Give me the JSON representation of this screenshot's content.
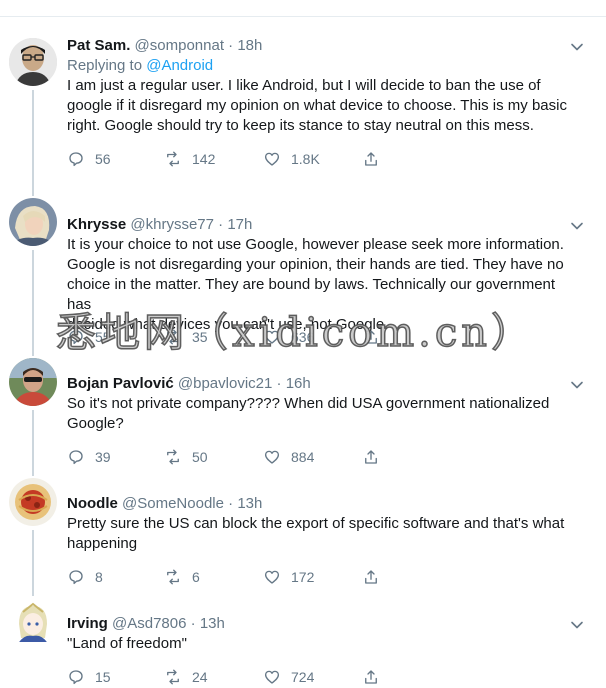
{
  "tweets": [
    {
      "name": "Pat Sam.",
      "handle": "@somponnat",
      "dot": "·",
      "time": "18h",
      "replying_prefix": "Replying to ",
      "replying_mention": "@Android",
      "lines": [
        "I am just a regular user. I like Android, but I will decide to ban the use of",
        "google if it disregard my opinion on what device to choose. This is my basic",
        "right. Google should try to keep its stance to stay neutral on this mess."
      ],
      "replies": "56",
      "retweets": "142",
      "likes": "1.8K"
    },
    {
      "name": "Khrysse",
      "handle": "@khrysse77",
      "dot": "·",
      "time": "17h",
      "lines": [
        "It is your choice to not use Google, however please seek more information.",
        "Google is not disregarding your opinion, their hands are tied. They have no",
        "choice in the matter. They are bound by laws. Technically our government has",
        "decided what devices you can't use, not Google."
      ],
      "replies": "55",
      "retweets": "35",
      "likes": "636"
    },
    {
      "name": "Bojan Pavlović",
      "handle": "@bpavlovic21",
      "dot": "·",
      "time": "16h",
      "lines": [
        "So it's not private company???? When did USA government nationalized",
        "Google?"
      ],
      "replies": "39",
      "retweets": "50",
      "likes": "884"
    },
    {
      "name": "Noodle",
      "handle": "@SomeNoodle",
      "dot": "·",
      "time": "13h",
      "lines": [
        "Pretty sure the US can block the export of specific software and that's what",
        "happening"
      ],
      "replies": "8",
      "retweets": "6",
      "likes": "172"
    },
    {
      "name": "Irving",
      "handle": "@Asd7806",
      "dot": "·",
      "time": "13h",
      "lines": [
        "\"Land of freedom\""
      ],
      "replies": "15",
      "retweets": "24",
      "likes": "724"
    }
  ],
  "watermark": "悉地网（xidicom.cn）",
  "icons": {
    "reply": "reply-icon",
    "retweet": "retweet-icon",
    "like": "heart-icon",
    "share": "share-icon",
    "more": "chevron-down-icon"
  },
  "colors": {
    "text": "#14171a",
    "muted": "#657786",
    "link": "#1da1f2",
    "thread_line": "#ccd6dd",
    "divider": "#e6ecf0"
  }
}
